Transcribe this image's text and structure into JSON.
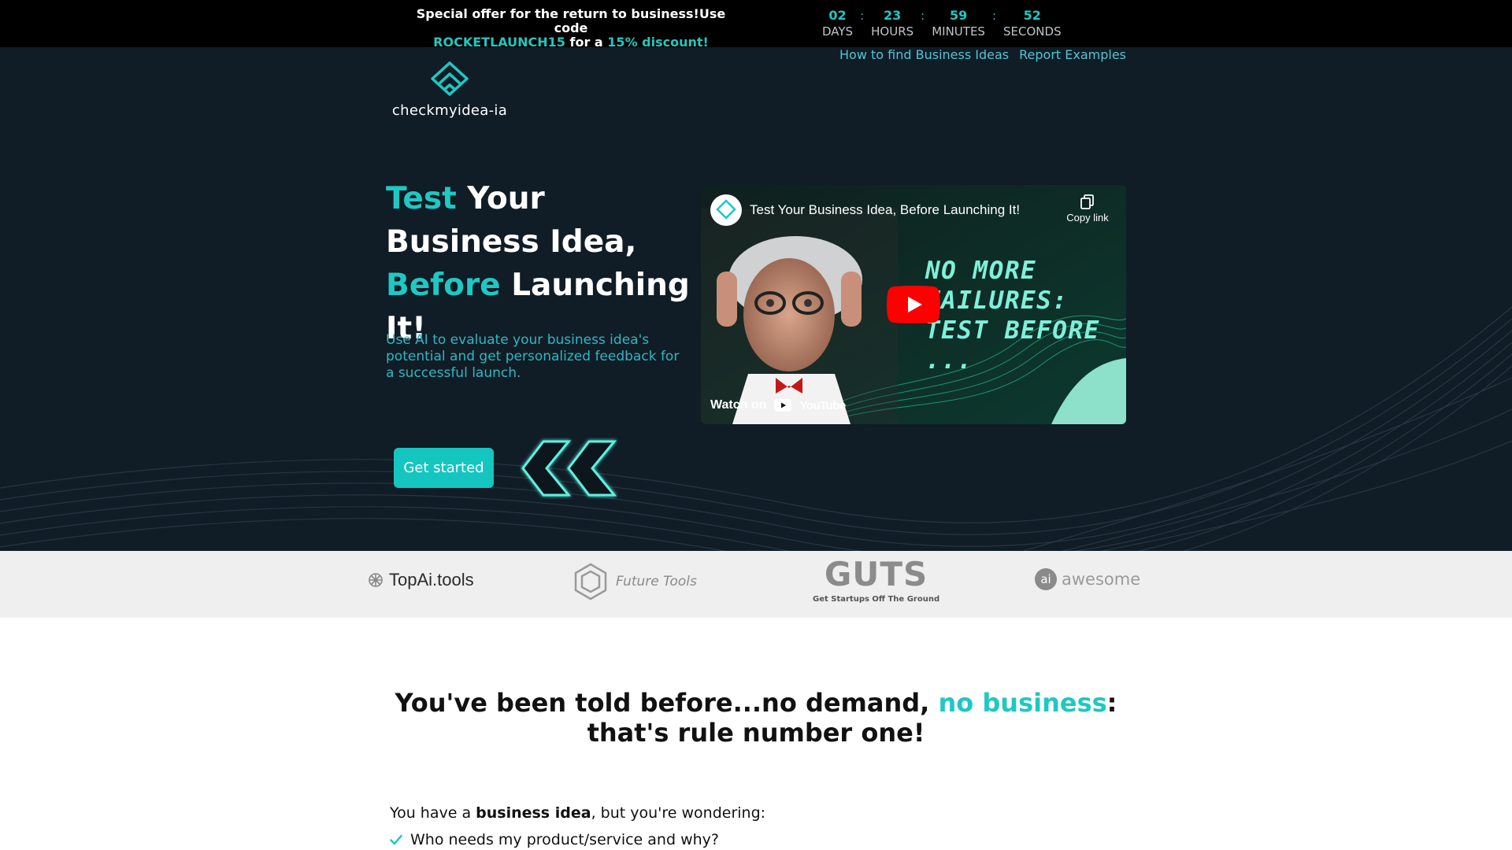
{
  "promo": {
    "text_line1": "Special offer for the return to business!Use code",
    "code": "ROCKETLAUNCH15",
    "mid": " for a ",
    "discount": "15% discount!",
    "countdown": [
      {
        "value": "02",
        "label": "DAYS"
      },
      {
        "value": "23",
        "label": "HOURS"
      },
      {
        "value": "59",
        "label": "MINUTES"
      },
      {
        "value": "52",
        "label": "SECONDS"
      }
    ],
    "separator": ":"
  },
  "nav": {
    "links": [
      "How to find Business Ideas",
      "Report Examples"
    ]
  },
  "logo": {
    "text": "checkmyidea-ia"
  },
  "hero": {
    "title_part1": "Test",
    "title_part2": " Your Business Idea, ",
    "title_part3": "Before",
    "title_part4": " Launching It!",
    "subtitle": "Use AI to evaluate your business idea's potential and get personalized feedback for a successful launch.",
    "cta_label": "Get started"
  },
  "video": {
    "title": "Test Your Business Idea, Before Launching It!",
    "copy_link": "Copy link",
    "watermark": "checkmyidea-ia",
    "overlay_lines": [
      "NO MORE",
      "FAILURES:",
      "TEST BEFORE",
      "..."
    ],
    "watch_on": "Watch on",
    "youtube": "YouTube"
  },
  "partners": {
    "topai": "TopAi.tools",
    "future_tools": "Future Tools",
    "guts": "GUTS",
    "guts_sub": "Get Startups Off The Ground",
    "awesome_badge": "ai",
    "awesome": "awesome"
  },
  "content": {
    "headline_part1": "You've been told before...no demand, ",
    "headline_accent": "no business",
    "headline_part2": ": that's rule number one!",
    "intro_part1": "You have a ",
    "intro_bold": "business idea",
    "intro_part2": ", but you're wondering:",
    "bullet1": "Who needs my product/service and why?"
  },
  "colors": {
    "accent": "#1fc8c2",
    "hero_bg": "#101c26",
    "promo_bg": "#000000",
    "partner_bg": "#efefef"
  }
}
